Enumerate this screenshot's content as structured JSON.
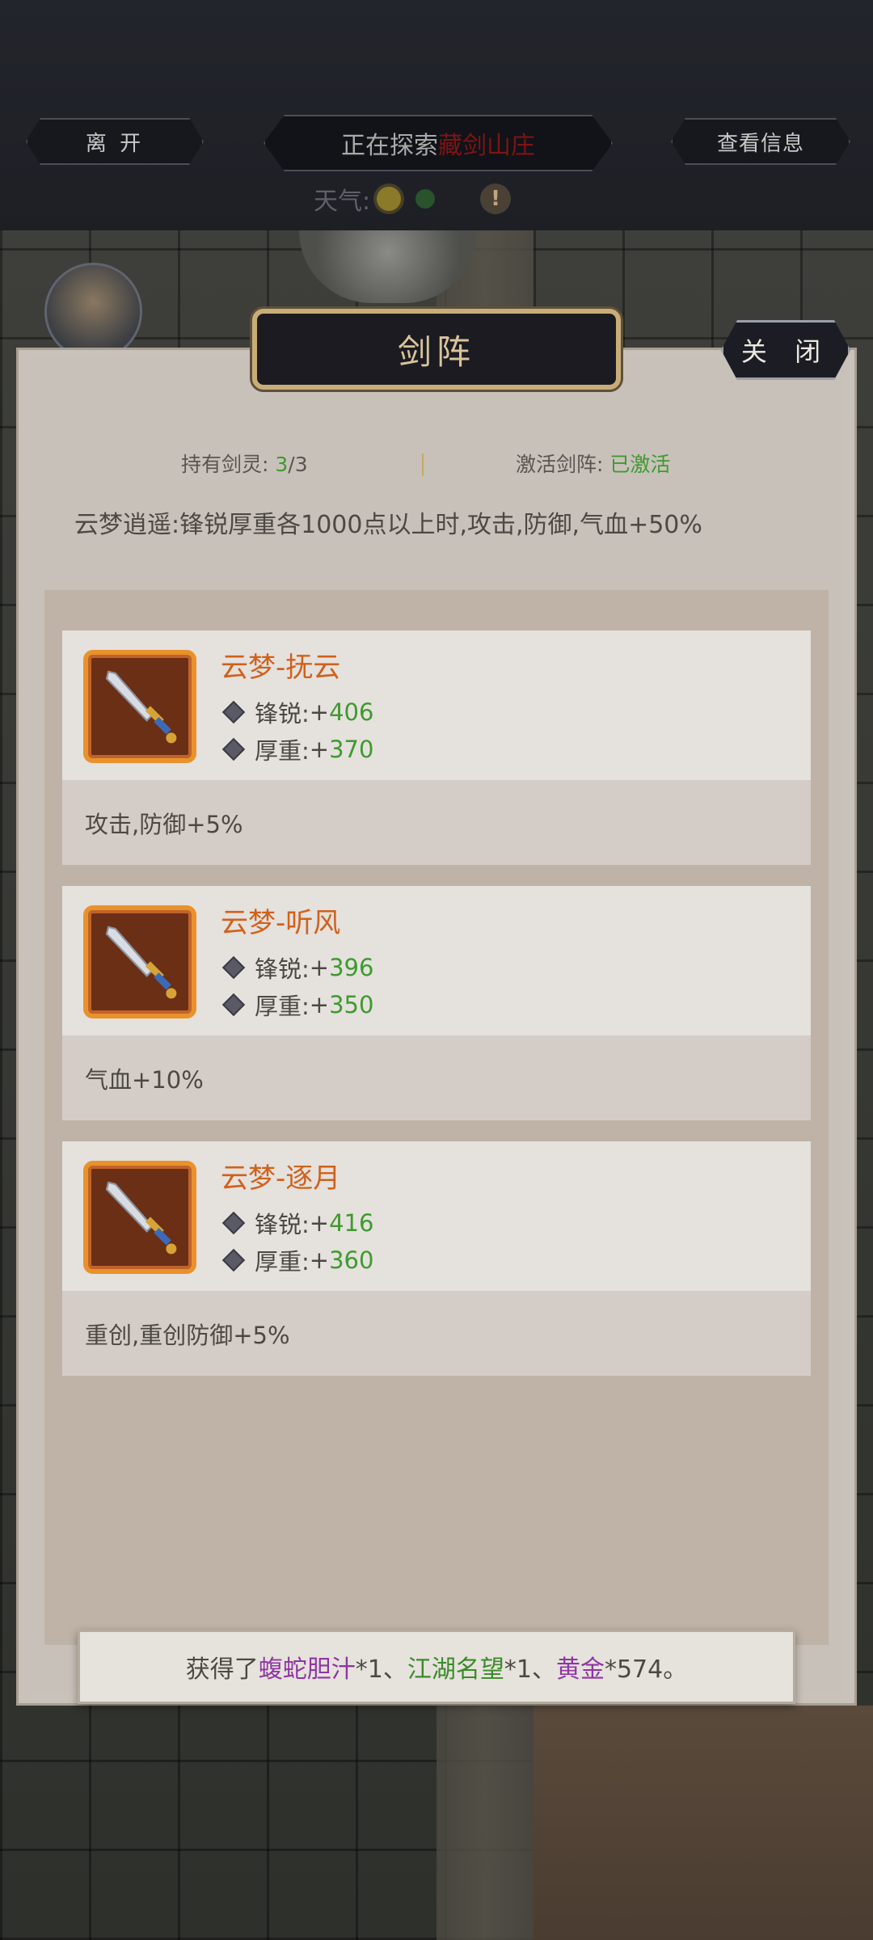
{
  "header": {
    "leave_label": "离 开",
    "info_label": "查看信息",
    "exploring_prefix": "正在探索",
    "location": "藏剑山庄",
    "weather_label": "天气:",
    "warning_symbol": "!"
  },
  "modal": {
    "title": "剑阵",
    "close_label": "关 闭",
    "held_label": "持有剑灵:",
    "held_count": "3",
    "held_total": "/3",
    "activate_label": "激活剑阵:",
    "activate_value": "已激活",
    "formation_desc": "云梦逍遥:锋锐厚重各1000点以上时,攻击,防御,气血+50%",
    "stat_sharp_label": "锋锐:",
    "stat_heavy_label": "厚重:",
    "plus": "+",
    "cards": [
      {
        "name": "云梦-抚云",
        "sharp": "406",
        "heavy": "370",
        "bonus": "攻击,防御+5%"
      },
      {
        "name": "云梦-听风",
        "sharp": "396",
        "heavy": "350",
        "bonus": "气血+10%"
      },
      {
        "name": "云梦-逐月",
        "sharp": "416",
        "heavy": "360",
        "bonus": "重创,重创防御+5%"
      }
    ]
  },
  "toast": {
    "prefix": "获得了",
    "item1": "蝮蛇胆汁",
    "qty1": "*1、",
    "item2": "江湖名望",
    "qty2": "*1、",
    "item3": "黄金",
    "qty3": "*574。"
  },
  "colors": {
    "accent_orange": "#d0611c",
    "stat_green": "#3f9a2f",
    "item_purple": "#8e35a4",
    "location_red": "#7e1414"
  }
}
